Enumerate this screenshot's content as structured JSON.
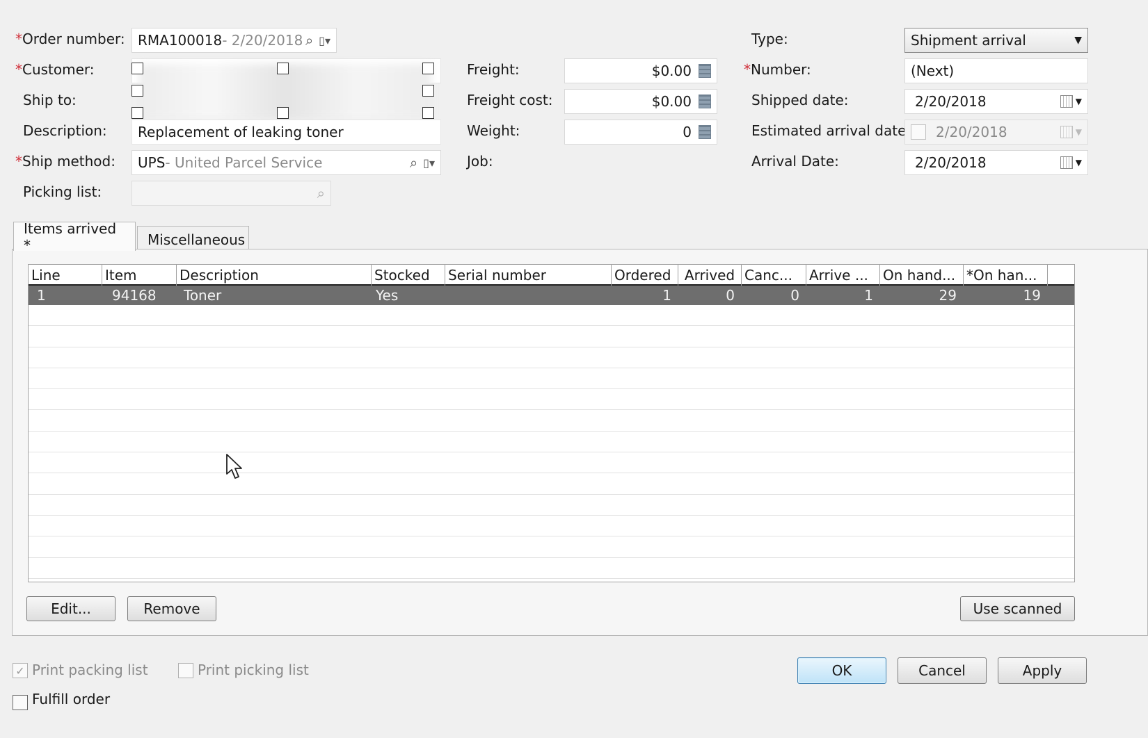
{
  "header": {
    "order_number": {
      "label": "Order number:",
      "value": "RMA100018",
      "suffix": " - 2/20/2018"
    },
    "customer": {
      "label": "Customer:"
    },
    "ship_to": {
      "label": "Ship to:"
    },
    "description": {
      "label": "Description:",
      "value": "Replacement of leaking toner"
    },
    "ship_method": {
      "label": "Ship method:",
      "value": "UPS",
      "suffix": " - United Parcel Service"
    },
    "picking_list": {
      "label": "Picking list:",
      "value": ""
    },
    "freight": {
      "label": "Freight:",
      "value": "$0.00"
    },
    "freight_cost": {
      "label": "Freight cost:",
      "value": "$0.00"
    },
    "weight": {
      "label": "Weight:",
      "value": "0"
    },
    "job": {
      "label": "Job:"
    },
    "type": {
      "label": "Type:",
      "value": "Shipment arrival"
    },
    "number": {
      "label": "Number:",
      "value": "(Next)"
    },
    "shipped_date": {
      "label": "Shipped date:",
      "value": "2/20/2018"
    },
    "estimated_arrival": {
      "label": "Estimated arrival date",
      "value": "2/20/2018"
    },
    "arrival_date": {
      "label": "Arrival Date:",
      "value": "2/20/2018"
    },
    "required_mark": "*"
  },
  "tabs": [
    {
      "label": "Items arrived *",
      "active": true
    },
    {
      "label": "Miscellaneous",
      "active": false
    }
  ],
  "grid": {
    "columns": [
      "Line",
      "Item",
      "Description",
      "Stocked",
      "Serial number",
      "Ordered",
      "Arrived",
      "Canc...",
      "Arrive ...",
      "On hand...",
      "*On han..."
    ],
    "rows": [
      {
        "line": "1",
        "item": "94168",
        "description": "Toner",
        "stocked": "Yes",
        "serial": "",
        "ordered": "1",
        "arrived": "0",
        "cancelled": "0",
        "arrive": "1",
        "on_hand": "29",
        "on_hand2": "19"
      }
    ]
  },
  "panel_buttons": {
    "edit": "Edit...",
    "remove": "Remove",
    "use_scanned": "Use scanned"
  },
  "footer": {
    "print_packing_list": {
      "label": "Print packing list",
      "checked": true
    },
    "print_picking_list": {
      "label": "Print picking list",
      "checked": false
    },
    "fulfill_order": {
      "label": "Fulfill order",
      "checked": false
    },
    "ok": "OK",
    "cancel": "Cancel",
    "apply": "Apply"
  },
  "colors": {
    "required": "#d0303a",
    "selected_row": "#6e6e6e",
    "primary_button": "#bfe3f8"
  }
}
